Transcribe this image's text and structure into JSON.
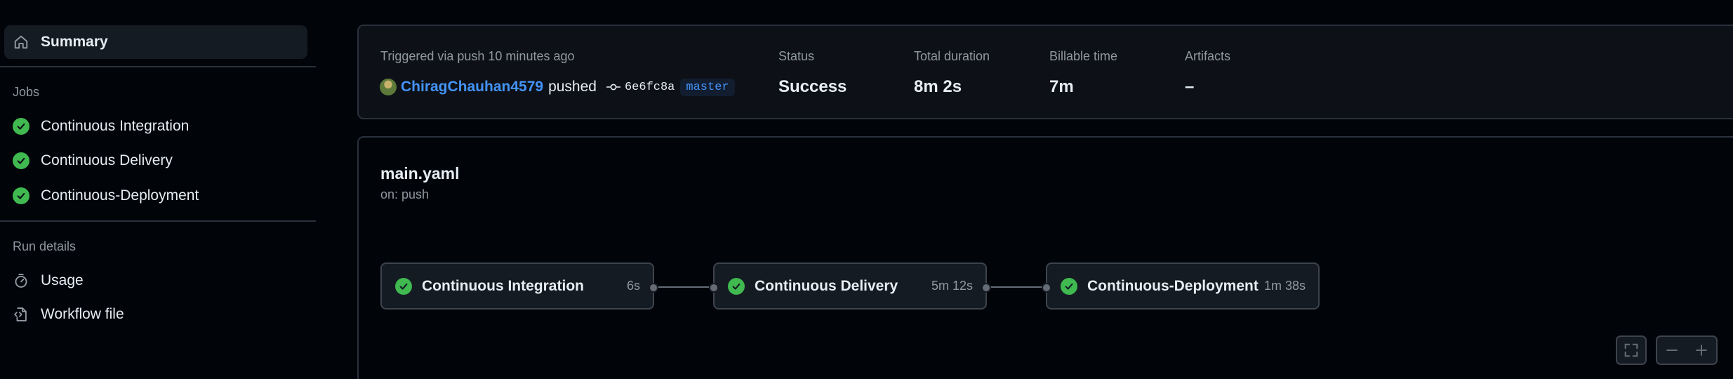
{
  "sidebar": {
    "summary_label": "Summary",
    "jobs_heading": "Jobs",
    "jobs": [
      {
        "label": "Continuous Integration"
      },
      {
        "label": "Continuous Delivery"
      },
      {
        "label": "Continuous-Deployment"
      }
    ],
    "run_details_heading": "Run details",
    "usage_label": "Usage",
    "workflow_file_label": "Workflow file"
  },
  "summary": {
    "trigger_text": "Triggered via push 10 minutes ago",
    "user": "ChiragChauhan4579",
    "action": "pushed",
    "commit": "6e6fc8a",
    "branch": "master",
    "stats": [
      {
        "label": "Status",
        "value": "Success"
      },
      {
        "label": "Total duration",
        "value": "8m 2s"
      },
      {
        "label": "Billable time",
        "value": "7m"
      },
      {
        "label": "Artifacts",
        "value": "–"
      }
    ]
  },
  "workflow": {
    "name": "main.yaml",
    "trigger": "on: push",
    "jobs": [
      {
        "name": "Continuous Integration",
        "duration": "6s"
      },
      {
        "name": "Continuous Delivery",
        "duration": "5m 12s"
      },
      {
        "name": "Continuous-Deployment",
        "duration": "1m 38s"
      }
    ]
  },
  "colors": {
    "success": "#3fb950",
    "link": "#4493f8",
    "background": "#010409",
    "surface": "#0d1117"
  }
}
